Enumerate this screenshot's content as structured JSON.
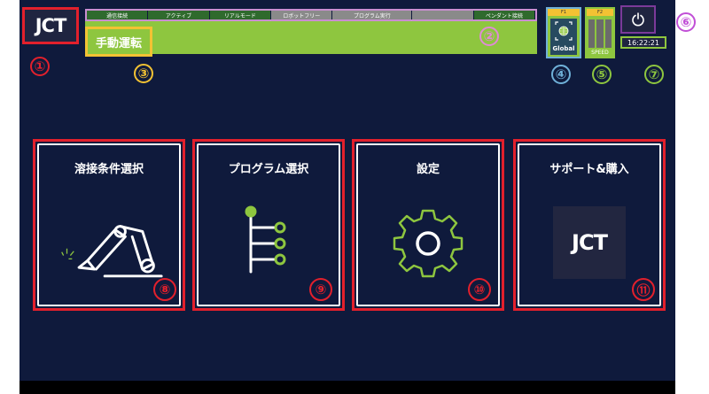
{
  "header": {
    "logo_text": "JCT",
    "status_items": [
      "通信接続",
      "アクティブ",
      "リアルモード",
      "ロボットフリー",
      "プログラム実行",
      "",
      "ペンダント接続"
    ],
    "mode_label": "手動運転",
    "coordinate_label": "Global",
    "coordinate_top": "F1",
    "speed_label": "SPEED",
    "speed_top": "F2",
    "clock": "16:22:21"
  },
  "callouts": [
    "①",
    "②",
    "③",
    "④",
    "⑤",
    "⑥",
    "⑦",
    "⑧",
    "⑨",
    "⑩",
    "⑪"
  ],
  "menu": {
    "tiles": [
      {
        "title": "溶接条件選択"
      },
      {
        "title": "プログラム選択"
      },
      {
        "title": "設定"
      },
      {
        "title": "サポート&購入"
      }
    ],
    "support_logo_text": "JCT"
  },
  "colors": {
    "background": "#0f1a3c",
    "accent_green": "#8ec63f",
    "highlight_red": "#e2202c",
    "highlight_yellow": "#f3c233"
  }
}
